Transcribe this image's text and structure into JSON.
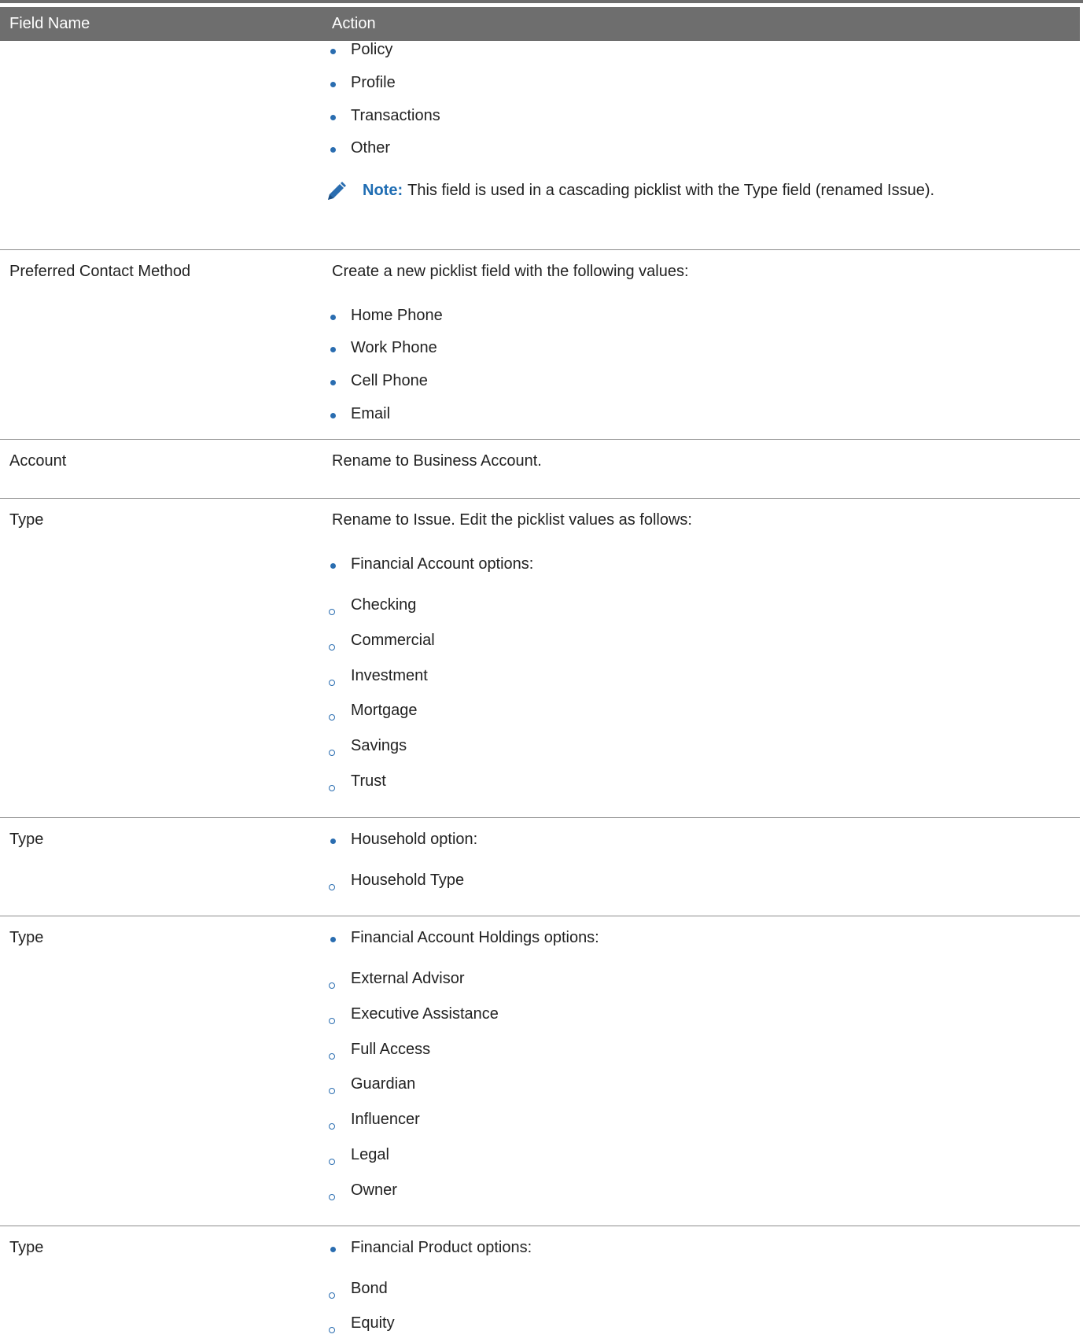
{
  "table": {
    "headers": {
      "field": "Field Name",
      "action": "Action"
    },
    "continued_items": [
      "Policy",
      "Profile",
      "Transactions",
      "Other"
    ],
    "note": {
      "icon": "pencil-icon",
      "label": "Note:",
      "text": "This field is used in a cascading picklist with the Type field (renamed Issue)."
    },
    "rows": [
      {
        "field": "Preferred Contact Method",
        "action": "Create a new picklist field with the following values:",
        "items": [
          "Home Phone",
          "Work Phone",
          "Cell Phone",
          "Email"
        ]
      },
      {
        "field": "Account",
        "action": "Rename to Business Account."
      },
      {
        "field": "Type",
        "action": "Rename to Issue. Edit the picklist values as follows:",
        "group": "Financial Account options:",
        "subitems": [
          "Checking",
          "Commercial",
          "Investment",
          "Mortgage",
          "Savings",
          "Trust"
        ]
      },
      {
        "field": "Type",
        "group": "Household option:",
        "subitems": [
          "Household Type"
        ]
      },
      {
        "field": "Type",
        "group": "Financial Account Holdings options:",
        "subitems": [
          "External Advisor",
          "Executive Assistance",
          "Full Access",
          "Guardian",
          "Influencer",
          "Legal",
          "Owner"
        ]
      },
      {
        "field": "Type",
        "group": "Financial Product options:",
        "subitems": [
          "Bond",
          "Equity"
        ]
      }
    ]
  },
  "colors": {
    "header_bg": "#6e6e6e",
    "bullet": "#2a6db0",
    "note_label": "#1f6db3"
  }
}
